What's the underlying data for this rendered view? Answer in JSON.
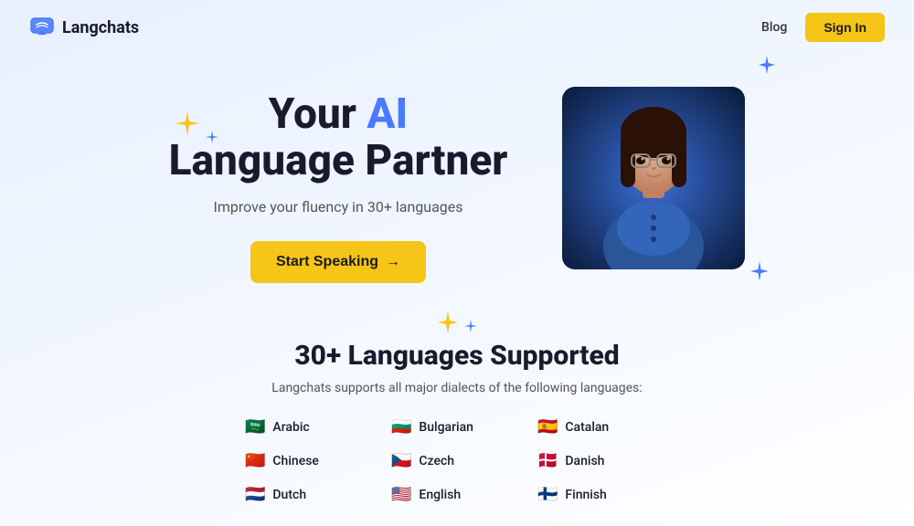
{
  "nav": {
    "logo_text": "Langchats",
    "blog_label": "Blog",
    "signin_label": "Sign In"
  },
  "hero": {
    "title_prefix": "Your ",
    "title_ai": "AI",
    "title_suffix": " Language Partner",
    "subtitle": "Improve your fluency in 30+ languages",
    "cta_label": "Start Speaking",
    "cta_arrow": "→"
  },
  "languages_section": {
    "title": "30+ Languages Supported",
    "subtitle": "Langchats supports all major dialects of the following languages:",
    "languages": [
      {
        "flag": "🇸🇦",
        "name": "Arabic"
      },
      {
        "flag": "🇧🇬",
        "name": "Bulgarian"
      },
      {
        "flag": "🇪🇸",
        "name": "Catalan"
      },
      {
        "flag": "🇨🇳",
        "name": "Chinese"
      },
      {
        "flag": "🇨🇿",
        "name": "Czech"
      },
      {
        "flag": "🇩🇰",
        "name": "Danish"
      },
      {
        "flag": "🇳🇱",
        "name": "Dutch"
      },
      {
        "flag": "🇺🇸",
        "name": "English"
      },
      {
        "flag": "🇫🇮",
        "name": "Finnish"
      }
    ]
  }
}
